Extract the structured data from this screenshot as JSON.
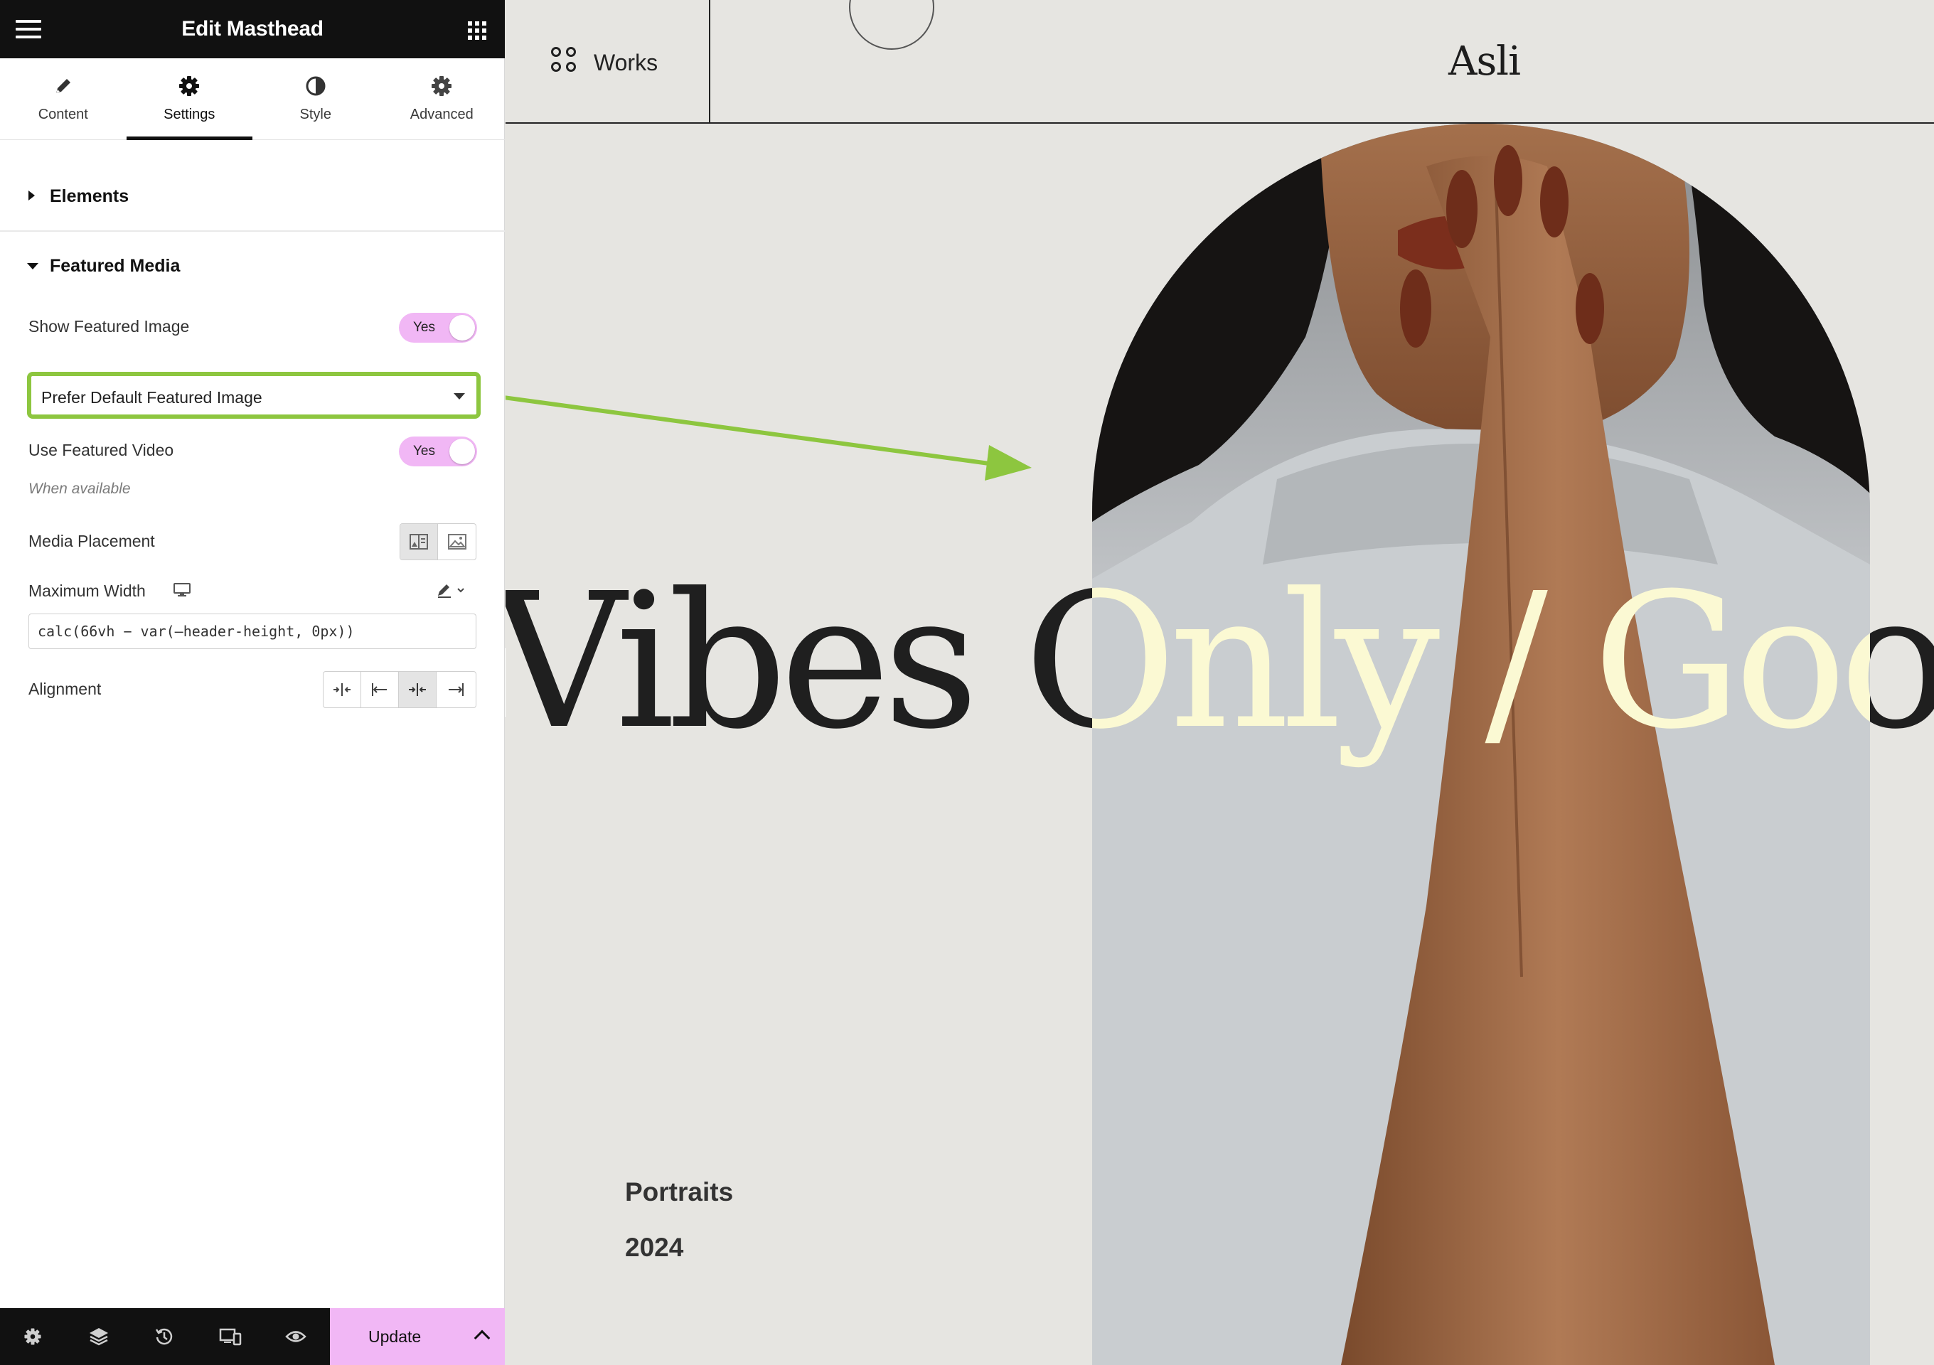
{
  "panel": {
    "title": "Edit Masthead",
    "tabs": [
      {
        "label": "Content",
        "icon": "pencil-icon"
      },
      {
        "label": "Settings",
        "icon": "gear-icon",
        "active": true
      },
      {
        "label": "Style",
        "icon": "half-circle-icon"
      },
      {
        "label": "Advanced",
        "icon": "gear-icon"
      }
    ],
    "sections": {
      "elements": "Elements",
      "featured_media": "Featured Media"
    },
    "controls": {
      "show_featured_image": {
        "label": "Show Featured Image",
        "value": "Yes"
      },
      "featured_image_source": {
        "value": "Prefer Default Featured Image"
      },
      "use_featured_video": {
        "label": "Use Featured Video",
        "value": "Yes",
        "hint": "When available"
      },
      "media_placement": {
        "label": "Media Placement",
        "options": [
          "beside-text-icon",
          "image-icon"
        ],
        "selected": 0
      },
      "maximum_width": {
        "label": "Maximum Width",
        "value": "calc(66vh − var(—header-height, 0px))"
      },
      "alignment": {
        "label": "Alignment",
        "options": [
          "align-stretch-icon",
          "align-start-icon",
          "align-center-icon",
          "align-end-icon"
        ],
        "selected": 2
      }
    },
    "footer": {
      "update_label": "Update",
      "icons": [
        "settings-icon",
        "layers-icon",
        "history-icon",
        "responsive-icon",
        "preview-eye-icon"
      ]
    }
  },
  "site": {
    "nav_label": "Works",
    "logo": "Asli",
    "hero_title": "Vibes Only  /  Good",
    "category": "Portraits",
    "year": "2024"
  },
  "colors": {
    "accent_pink": "#f1b7f5",
    "highlight_green": "#8dc63f",
    "page_bg": "#e6e5e1",
    "hero_light_text": "#fbf9d3"
  }
}
